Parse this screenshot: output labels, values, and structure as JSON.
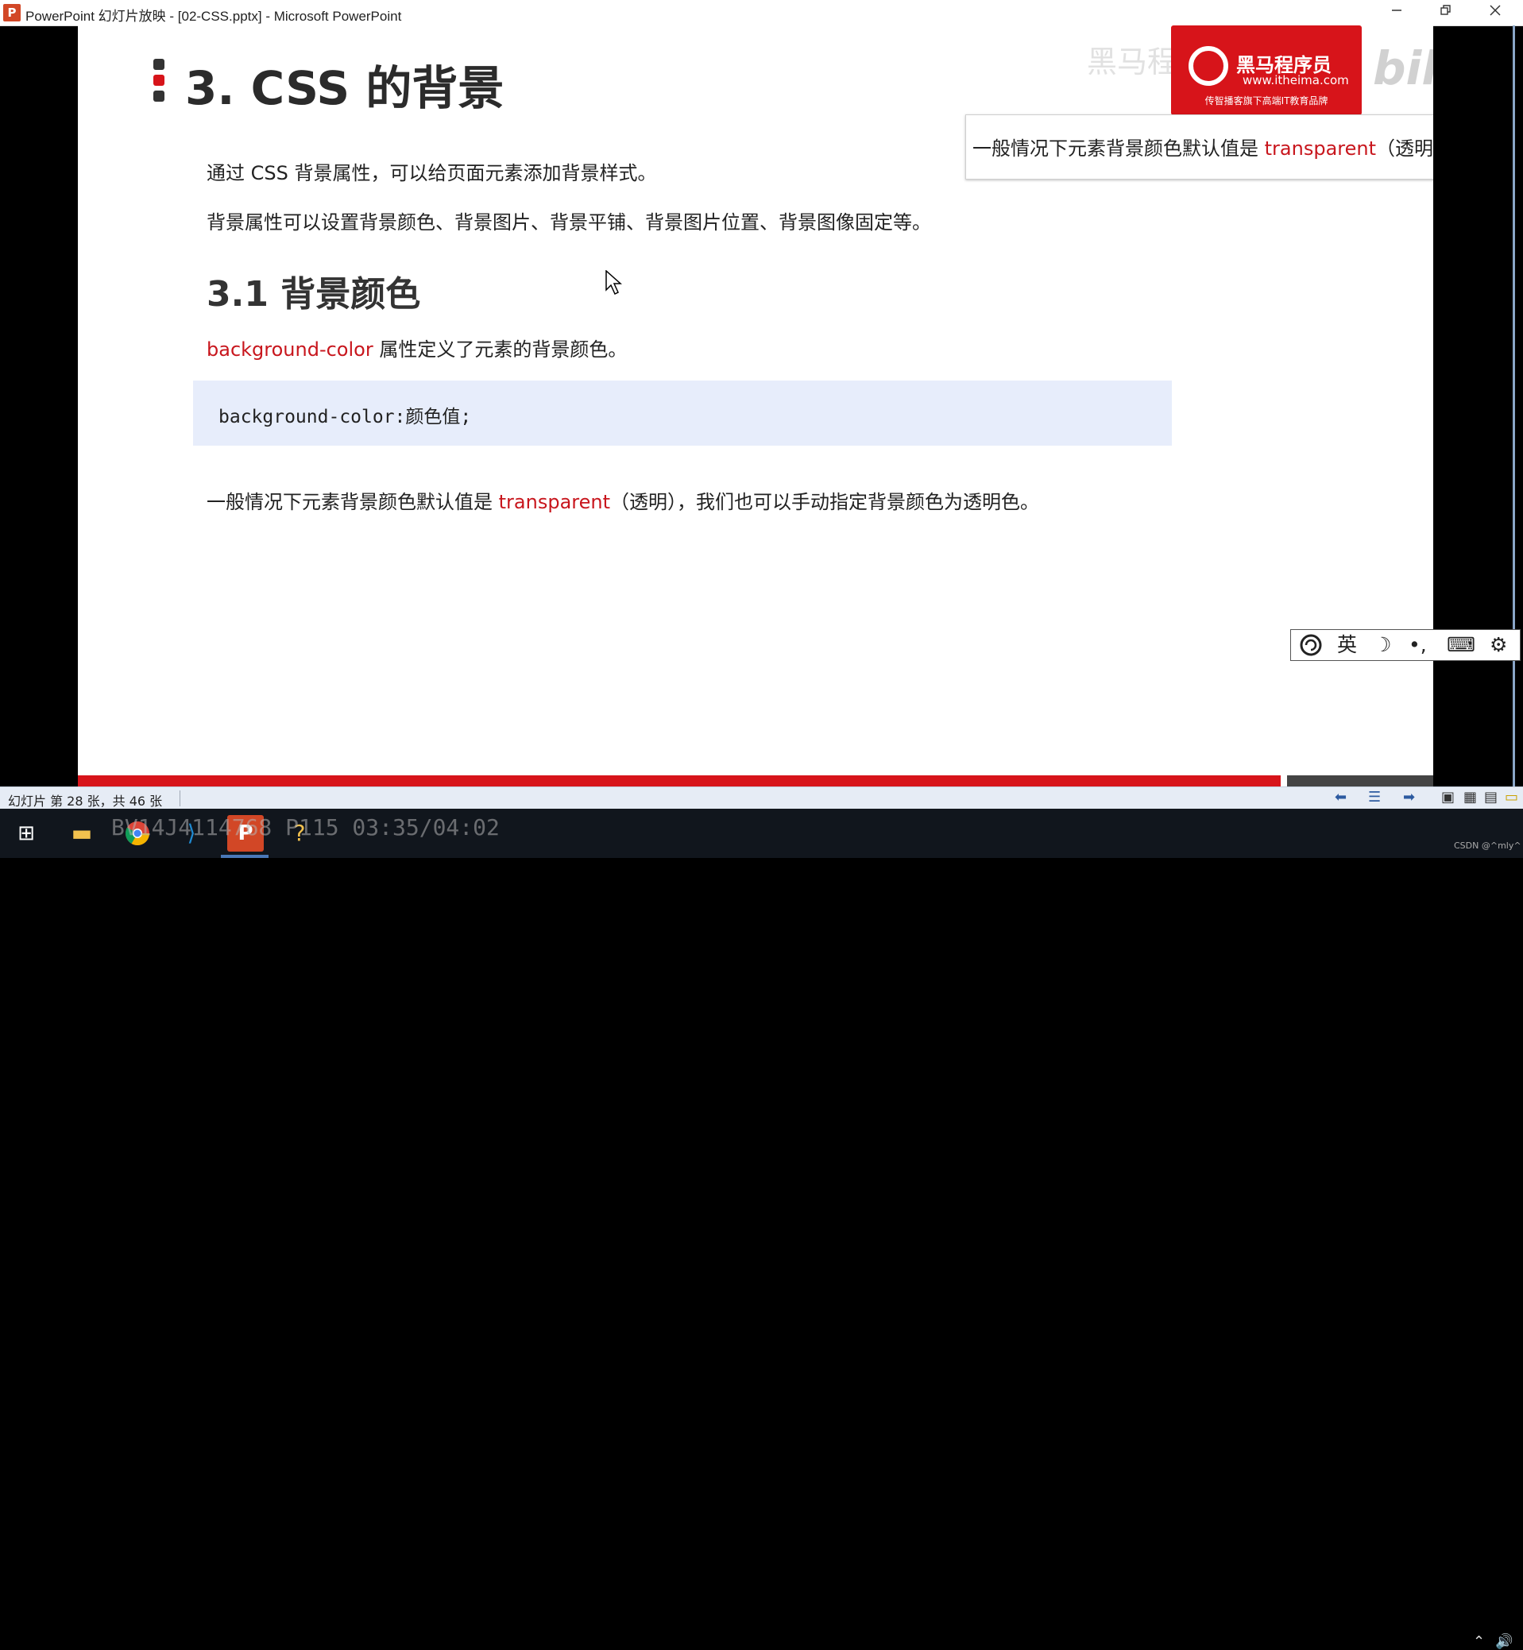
{
  "window": {
    "app_icon": "P",
    "title": "PowerPoint 幻灯片放映 - [02-CSS.pptx] - Microsoft PowerPoint",
    "minimize_icon": "minimize-icon",
    "restore_icon": "restore-icon",
    "close_icon": "close-icon"
  },
  "slide": {
    "title": "3. CSS 的背景",
    "intro1": "通过 CSS 背景属性，可以给页面元素添加背景样式。",
    "intro2": "背景属性可以设置背景颜色、背景图片、背景平铺、背景图片位置、背景图像固定等。",
    "subheading": "3.1  背景颜色",
    "prop_keyword": "background-color",
    "prop_desc": " 属性定义了元素的背景颜色。",
    "code": "background-color:颜色值;",
    "note_prefix": "一般情况下元素背景颜色默认值是 ",
    "note_keyword": "transparent",
    "note_suffix": "（透明），我们也可以手动指定背景颜色为透明色。",
    "tooltip_prefix": "一般情况下元素背景颜色默认值是 ",
    "tooltip_keyword": "transparent",
    "tooltip_suffix": "（透明）",
    "logo": {
      "name": "黑马程序员",
      "url": "www.itheima.com",
      "tagline": "传智播客旗下高端IT教育品牌"
    },
    "watermark": "黑马程序员pink老师",
    "bili_mark": "bilibili"
  },
  "ime": {
    "lang": "英"
  },
  "statusbar": {
    "slide_info": "幻灯片 第 28 张，共 46 张"
  },
  "overlay": {
    "video_info": "BV14J4114768 P115 03:35/04:02"
  },
  "tray": {
    "csdn": "CSDN @^mly^"
  },
  "colors": {
    "accent_red": "#c8161d",
    "code_bg": "#e7edfb",
    "status_bg": "#e6ecf5",
    "taskbar_bg": "#11161d"
  }
}
